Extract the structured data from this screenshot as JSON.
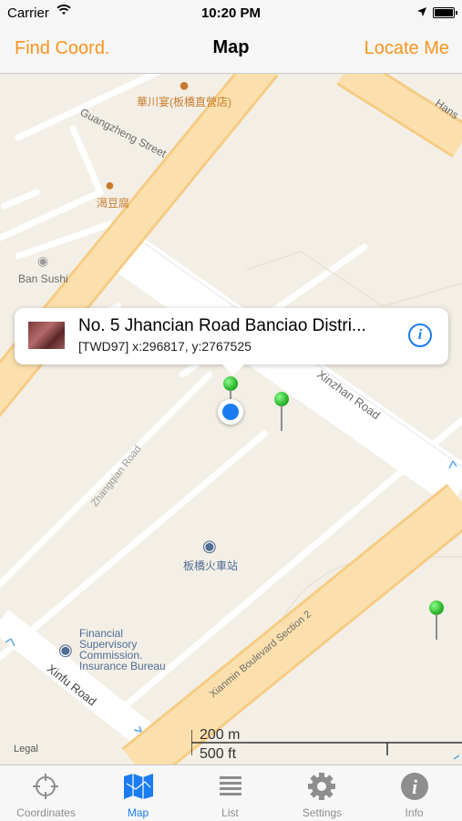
{
  "status_bar": {
    "carrier": "Carrier",
    "time": "10:20 PM"
  },
  "nav": {
    "left_button": "Find Coord.",
    "title": "Map",
    "right_button": "Locate Me"
  },
  "map": {
    "labels": {
      "guangzheng": "Guangzheng Street",
      "restaurant": "華川宴(板橋直營店)",
      "tofu": "渴豆腐",
      "ban_sushi": "Ban Sushi",
      "hans": "Hans",
      "xinzhan": "Xinzhan Road",
      "zhangqian": "Zhangqian Road",
      "station": "板橋火車站",
      "fsc_1": "Financial",
      "fsc_2": "Supervisory",
      "fsc_3": "Commission.",
      "fsc_4": "Insurance Bureau",
      "xinfu": "Xinfu Road",
      "xianmin": "Xianmin Boulevard Section 2",
      "legal": "Legal",
      "scale_m": "200 m",
      "scale_ft": "500 ft"
    },
    "callout": {
      "title": "No. 5 Jhancian Road Banciao Distri...",
      "subtitle": "[TWD97] x:296817, y:2767525"
    }
  },
  "tabs": [
    {
      "label": "Coordinates",
      "icon": "crosshair-icon"
    },
    {
      "label": "Map",
      "icon": "map-icon"
    },
    {
      "label": "List",
      "icon": "list-icon"
    },
    {
      "label": "Settings",
      "icon": "gear-icon"
    },
    {
      "label": "Info",
      "icon": "info-icon"
    }
  ],
  "colors": {
    "accent": "#f7941d",
    "tint": "#1a7cf0",
    "pin": "#29b529"
  }
}
